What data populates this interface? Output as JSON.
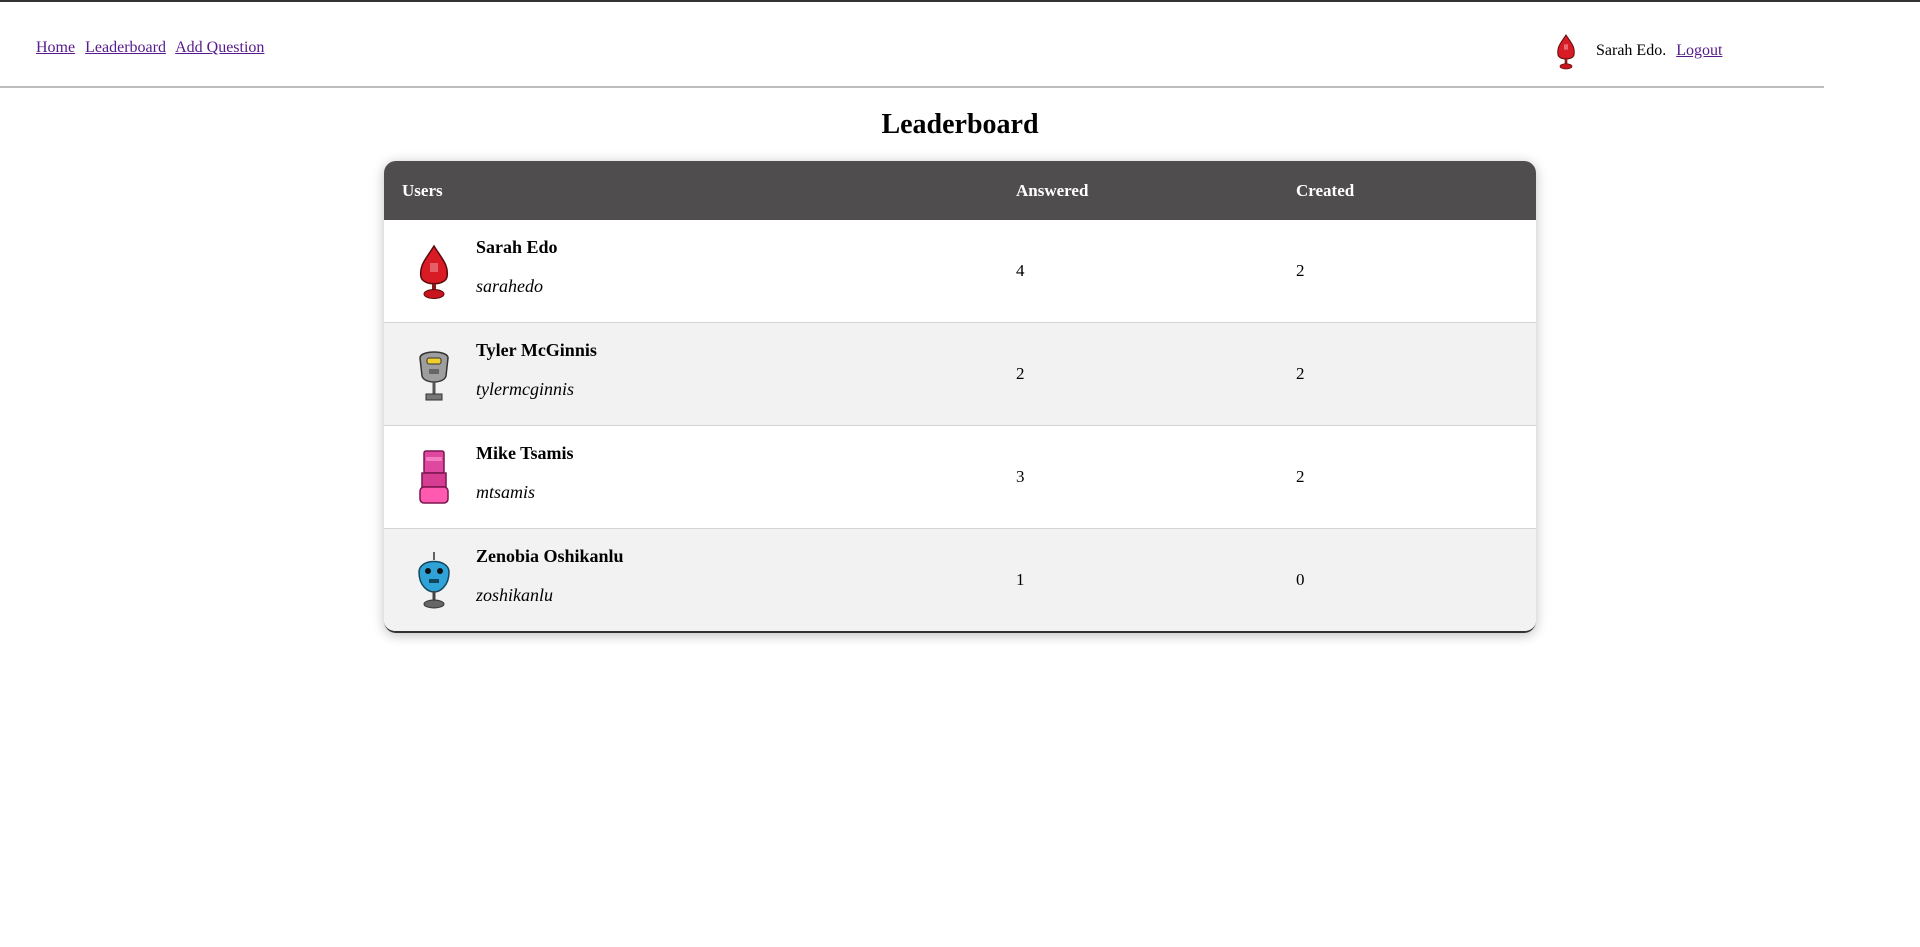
{
  "nav": {
    "links": [
      "Home",
      "Leaderboard",
      "Add Question"
    ],
    "user_name": "Sarah Edo.",
    "logout_label": "Logout"
  },
  "page": {
    "title": "Leaderboard"
  },
  "table": {
    "headers": {
      "users": "Users",
      "answered": "Answered",
      "created": "Created"
    },
    "rows": [
      {
        "name": "Sarah Edo",
        "handle": "sarahedo",
        "answered": "4",
        "created": "2",
        "avatar": "red-robot-icon"
      },
      {
        "name": "Tyler McGinnis",
        "handle": "tylermcginnis",
        "answered": "2",
        "created": "2",
        "avatar": "gray-robot-icon"
      },
      {
        "name": "Mike Tsamis",
        "handle": "mtsamis",
        "answered": "3",
        "created": "2",
        "avatar": "pink-robot-icon"
      },
      {
        "name": "Zenobia Oshikanlu",
        "handle": "zoshikanlu",
        "answered": "1",
        "created": "0",
        "avatar": "blue-robot-icon"
      }
    ]
  },
  "colors": {
    "header_bg": "#4f4d4e",
    "link": "#551a8b",
    "alt_row": "#f2f2f2"
  }
}
